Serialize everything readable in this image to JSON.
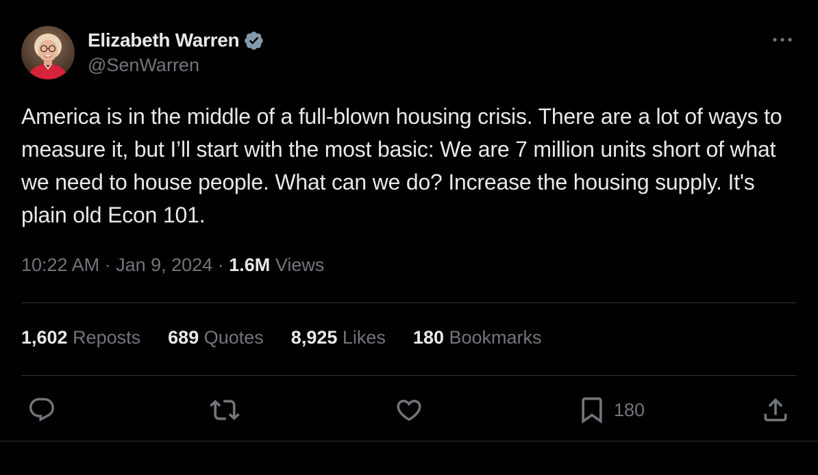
{
  "author": {
    "display_name": "Elizabeth Warren",
    "handle": "@SenWarren",
    "verified": true,
    "verified_color": "#829aab"
  },
  "tweet": {
    "text": "America is in the middle of a full-blown housing crisis. There are a lot of ways to measure it, but I’ll start with the most basic: We are 7 million units short of what we need to house people. What can we do? Increase the housing supply. It's plain old Econ 101."
  },
  "meta": {
    "time": "10:22 AM",
    "separator": "·",
    "date": "Jan 9, 2024",
    "views_count": "1.6M",
    "views_label": "Views"
  },
  "stats": {
    "reposts": {
      "count": "1,602",
      "label": "Reposts"
    },
    "quotes": {
      "count": "689",
      "label": "Quotes"
    },
    "likes": {
      "count": "8,925",
      "label": "Likes"
    },
    "bookmarks": {
      "count": "180",
      "label": "Bookmarks"
    }
  },
  "actions": {
    "reply_icon": "reply-icon",
    "retweet_icon": "retweet-icon",
    "like_icon": "heart-icon",
    "bookmark_icon": "bookmark-icon",
    "bookmark_count": "180",
    "share_icon": "share-icon"
  },
  "colors": {
    "background": "#000000",
    "text_primary": "#e7e9ea",
    "text_secondary": "#71767b",
    "divider": "#2f3336"
  }
}
